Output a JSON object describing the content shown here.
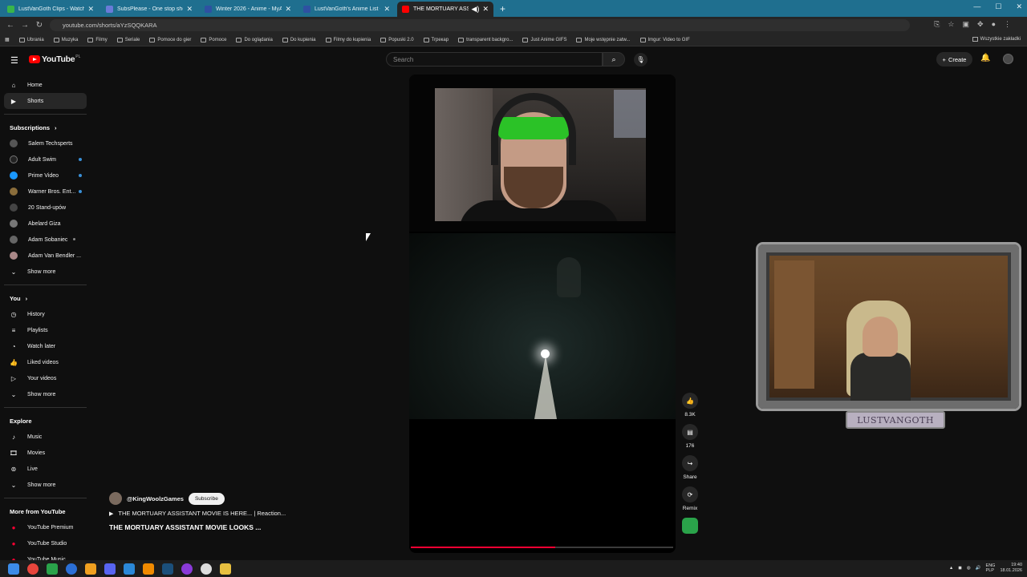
{
  "browser": {
    "tabs": [
      {
        "title": "LustVanGoth Clips - Watch Live",
        "color": "#39b54a"
      },
      {
        "title": "SubsPlease - One stop shop fo",
        "color": "#6a7bd8"
      },
      {
        "title": "Winter 2026 - Anime - MyAnim",
        "color": "#2e51a2"
      },
      {
        "title": "LustVanGoth's Anime List - My",
        "color": "#2e51a2"
      },
      {
        "title": "THE MORTUARY ASSISTAN",
        "color": "#ff0000"
      }
    ],
    "new_tab": "+",
    "url": "youtube.com/shorts/aYzSQQKARA",
    "bookmarks": [
      "Ubrania",
      "Muzyka",
      "Filmy",
      "Seriale",
      "Pomoce do gier",
      "Pomoce",
      "Do oglądania",
      "Do kupienia",
      "Filmy do kupienia",
      "Popuski 2.0",
      "Trpeкар",
      "transparent backgro...",
      "Just Anime GIFS",
      "Moje wstępnie zatw...",
      "Imgur: Video to GIF"
    ],
    "bookmarks_right": "Wszystkie zakładki"
  },
  "header": {
    "logo": "YouTube",
    "logo_region": "PL",
    "search_placeholder": "Search",
    "create_label": "Create"
  },
  "sidebar": {
    "main": [
      {
        "label": "Home",
        "icon": "home-icon"
      },
      {
        "label": "Shorts",
        "icon": "shorts-icon",
        "active": true
      }
    ],
    "subscriptions_title": "Subscriptions",
    "subscriptions": [
      {
        "label": "Salem Techsperts",
        "color": "#555",
        "dot": false
      },
      {
        "label": "Adult Swim",
        "color": "#222",
        "dot": true
      },
      {
        "label": "Prime Video",
        "color": "#1a98ff",
        "dot": true
      },
      {
        "label": "Warner Bros. Ent...",
        "color": "#8a6d3b",
        "dot": true
      },
      {
        "label": "20 Stand-upów",
        "color": "#444",
        "dot": false
      },
      {
        "label": "Abelard Giza",
        "color": "#777",
        "dot": false
      },
      {
        "label": "Adam Sobaniec",
        "color": "#666",
        "dot": true
      },
      {
        "label": "Adam Van Bendler ...",
        "color": "#a88",
        "dot": false
      }
    ],
    "subs_show_more": "Show more",
    "you_title": "You",
    "you": [
      {
        "label": "History",
        "icon": "history-icon"
      },
      {
        "label": "Playlists",
        "icon": "playlists-icon"
      },
      {
        "label": "Watch later",
        "icon": "watch-later-icon"
      },
      {
        "label": "Liked videos",
        "icon": "liked-videos-icon"
      },
      {
        "label": "Your videos",
        "icon": "your-videos-icon"
      }
    ],
    "you_show_more": "Show more",
    "explore_title": "Explore",
    "explore": [
      {
        "label": "Music",
        "icon": "music-icon"
      },
      {
        "label": "Movies",
        "icon": "movies-icon"
      },
      {
        "label": "Live",
        "icon": "live-icon"
      }
    ],
    "explore_show_more": "Show more",
    "more_title": "More from YouTube",
    "more": [
      {
        "label": "YouTube Premium"
      },
      {
        "label": "YouTube Studio"
      },
      {
        "label": "YouTube Music"
      }
    ]
  },
  "short": {
    "channel": "@KingWoolzGames",
    "subscribe_label": "Subscribe",
    "video_link": "THE MORTUARY ASSISTANT MOVIE IS HERE... | Reaction...",
    "title": "THE MORTUARY ASSISTANT MOVIE LOOKS ...",
    "progress": 0.55,
    "actions": {
      "likes": "8.3K",
      "comments": "176",
      "share": "Share",
      "remix": "Remix"
    }
  },
  "overlay": {
    "label": "LUSTVANGOTH"
  },
  "taskbar": {
    "lang": "ENG\nPLP",
    "time": "19:40",
    "date": "18.01.2026"
  }
}
